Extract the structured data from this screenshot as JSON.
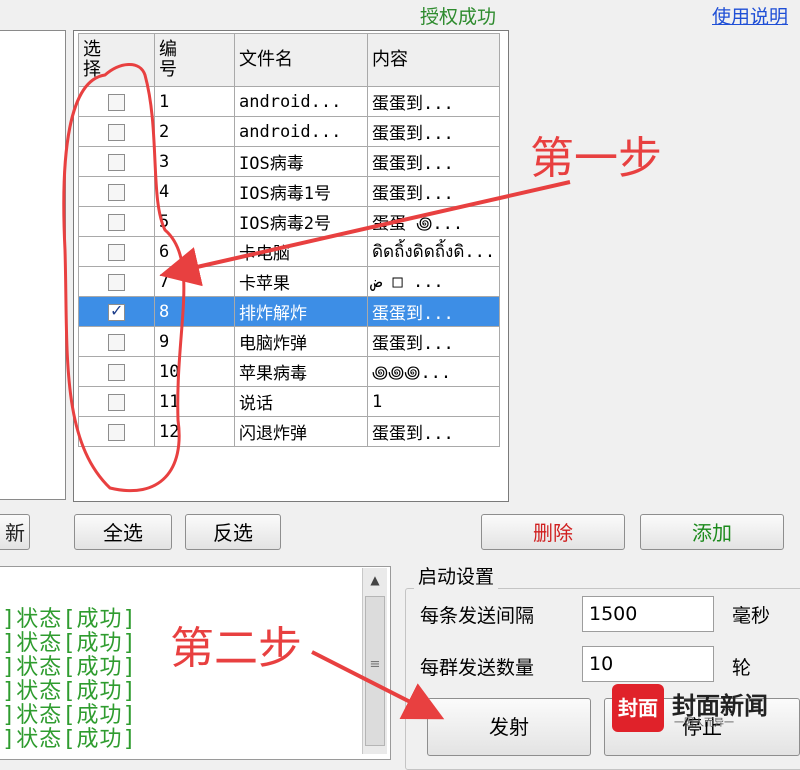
{
  "header": {
    "status": "授权成功",
    "help_link": "使用说明"
  },
  "table": {
    "headers": {
      "select": "选择",
      "number": "编号",
      "filename": "文件名",
      "content": "内容"
    },
    "rows": [
      {
        "num": "1",
        "filename": "android...",
        "content": "蛋蛋到...",
        "checked": false
      },
      {
        "num": "2",
        "filename": "android...",
        "content": "蛋蛋到...",
        "checked": false
      },
      {
        "num": "3",
        "filename": "IOS病毒",
        "content": "蛋蛋到...",
        "checked": false
      },
      {
        "num": "4",
        "filename": "IOS病毒1号",
        "content": "蛋蛋到...",
        "checked": false
      },
      {
        "num": "5",
        "filename": "IOS病毒2号",
        "content": "蛋蛋 ꩜...",
        "checked": false
      },
      {
        "num": "6",
        "filename": "卡电脑",
        "content": "ดิดถิ้งดิดถิ้งดิ...",
        "checked": false
      },
      {
        "num": "7",
        "filename": "卡苹果",
        "content": "ض □ ...",
        "checked": false
      },
      {
        "num": "8",
        "filename": "排炸解炸",
        "content": "蛋蛋到...",
        "checked": true
      },
      {
        "num": "9",
        "filename": "电脑炸弹",
        "content": "蛋蛋到...",
        "checked": false
      },
      {
        "num": "10",
        "filename": "苹果病毒",
        "content": " ꩜꩜꩜...",
        "checked": false
      },
      {
        "num": "11",
        "filename": "说话",
        "content": "1",
        "checked": false
      },
      {
        "num": "12",
        "filename": "闪退炸弹",
        "content": "蛋蛋到...",
        "checked": false
      }
    ],
    "selected_row_color": "#3d8ee6"
  },
  "buttons": {
    "refresh": "新",
    "select_all": "全选",
    "invert": "反选",
    "delete": "删除",
    "add": "添加",
    "send": "发射",
    "stop": "停止"
  },
  "log": {
    "lines": [
      "]状态[成功]",
      "]状态[成功]",
      "]状态[成功]",
      "]状态[成功]",
      "]状态[成功]",
      "]状态[成功]"
    ]
  },
  "settings": {
    "title": "启动设置",
    "interval_label": "每条发送间隔",
    "interval_value": "1500",
    "interval_unit": "毫秒",
    "count_label": "每群发送数量",
    "count_value": "10",
    "count_unit": "轮"
  },
  "annotations": {
    "step1": "第一步",
    "step2": "第二步",
    "color": "#e84040"
  },
  "watermark": {
    "logo": "封面",
    "name": "封面新闻",
    "tagline": "一因人而异一"
  }
}
